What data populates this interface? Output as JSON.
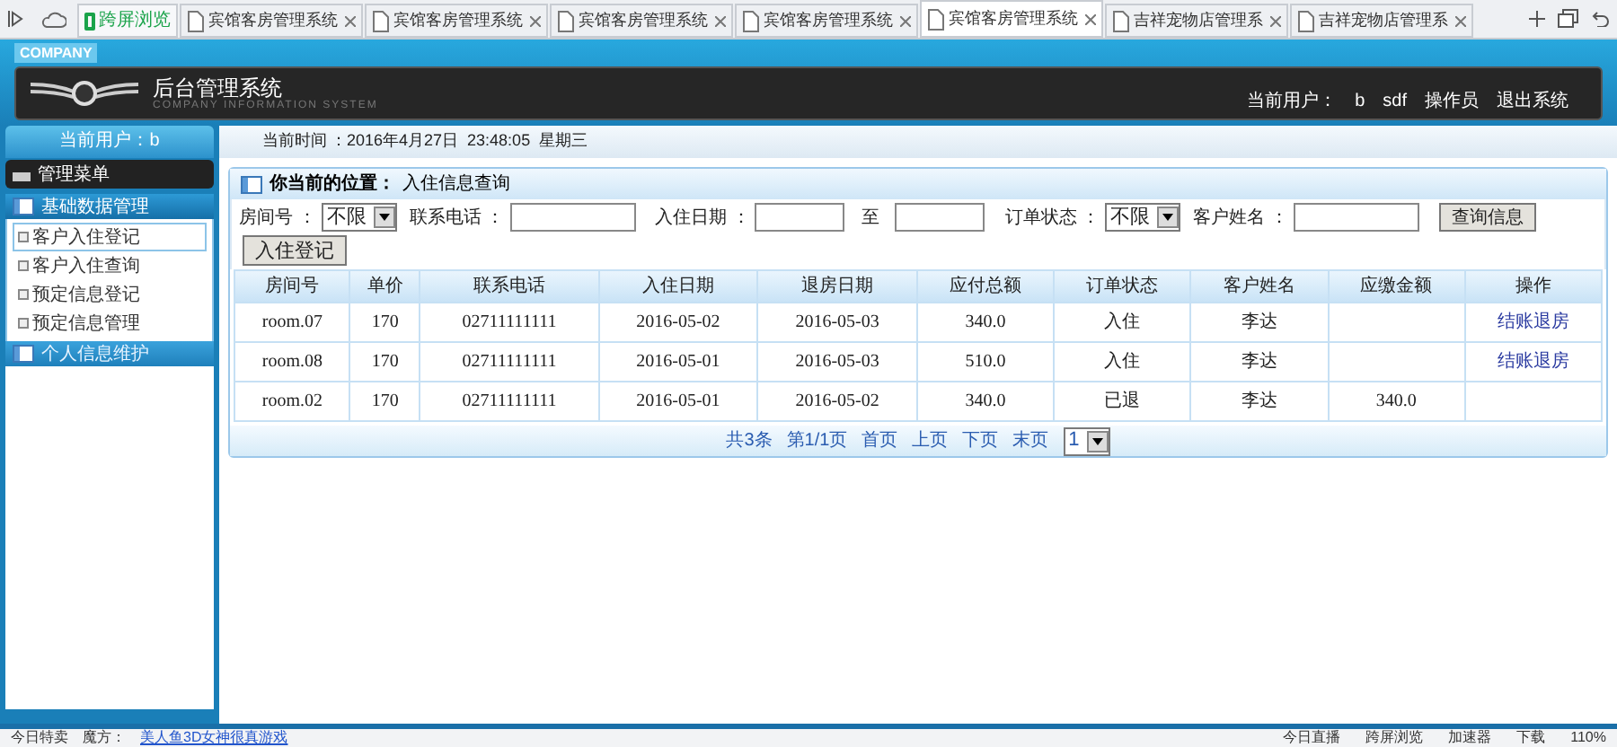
{
  "browser_tabs": [
    {
      "label": "跨屏浏览",
      "kind": "app",
      "selected": false
    },
    {
      "label": "宾馆客房管理系统",
      "kind": "page",
      "selected": false
    },
    {
      "label": "宾馆客房管理系统",
      "kind": "page",
      "selected": false
    },
    {
      "label": "宾馆客房管理系统",
      "kind": "page",
      "selected": false
    },
    {
      "label": "宾馆客房管理系统",
      "kind": "page",
      "selected": false
    },
    {
      "label": "宾馆客房管理系统",
      "kind": "page",
      "selected": true
    },
    {
      "label": "吉祥宠物店管理系",
      "kind": "page",
      "selected": false
    },
    {
      "label": "吉祥宠物店管理系",
      "kind": "page",
      "selected": false
    }
  ],
  "header": {
    "badge": "COMPANY",
    "title": "后台管理系统",
    "subtitle": "COMPANY INFORMATION SYSTEM",
    "user_label": "当前用户：",
    "user": "b",
    "user_name": "sdf",
    "role": "操作员",
    "logout": "退出系统"
  },
  "sidebar": {
    "current_user": "当前用户：b",
    "menu_title": "管理菜单",
    "groups": [
      {
        "title": "基础数据管理",
        "expanded": true,
        "items": [
          {
            "label": "客户入住登记",
            "selected": true
          },
          {
            "label": "客户入住查询",
            "selected": false
          },
          {
            "label": "预定信息登记",
            "selected": false
          },
          {
            "label": "预定信息管理",
            "selected": false
          }
        ]
      },
      {
        "title": "个人信息维护",
        "expanded": false
      }
    ]
  },
  "time_bar": {
    "label": "当前时间",
    "value": "：2016年4月27日  23:48:05  星期三"
  },
  "breadcrumb": {
    "label": "你当前的位置：",
    "page": "入住信息查询"
  },
  "filters": {
    "room_label": "房间号 ：",
    "room_value": "不限",
    "phone_label": "联系电话 ：",
    "date_label": "入住日期 ：",
    "to_label": "至",
    "status_label": "订单状态 ：",
    "status_value": "不限",
    "name_label": "客户姓名 ：",
    "search_button": "查询信息",
    "checkin_button": "入住登记"
  },
  "table": {
    "columns": [
      "房间号",
      "单价",
      "联系电话",
      "入住日期",
      "退房日期",
      "应付总额",
      "订单状态",
      "客户姓名",
      "应缴金额",
      "操作"
    ],
    "rows": [
      [
        "room.07",
        "170",
        "02711111111",
        "2016-05-02",
        "2016-05-03",
        "340.0",
        "入住",
        "李达",
        "",
        "结账退房"
      ],
      [
        "room.08",
        "170",
        "02711111111",
        "2016-05-01",
        "2016-05-03",
        "510.0",
        "入住",
        "李达",
        "",
        "结账退房"
      ],
      [
        "room.02",
        "170",
        "02711111111",
        "2016-05-01",
        "2016-05-02",
        "340.0",
        "已退",
        "李达",
        "340.0",
        ""
      ]
    ]
  },
  "pagination": {
    "total": "共3条",
    "page": "第1/1页",
    "first": "首页",
    "prev": "上页",
    "next": "下页",
    "last": "末页",
    "current": "1"
  },
  "status_bar": {
    "left": [
      {
        "label": "今日特卖",
        "kind": "text"
      },
      {
        "label": "魔方：",
        "kind": "text"
      },
      {
        "label": "美人鱼3D女神很真游戏",
        "kind": "link"
      }
    ],
    "right": [
      {
        "label": "今日直播"
      },
      {
        "label": "跨屏浏览"
      },
      {
        "label": "加速器"
      },
      {
        "label": "下载"
      },
      {
        "label": "110%"
      }
    ]
  }
}
